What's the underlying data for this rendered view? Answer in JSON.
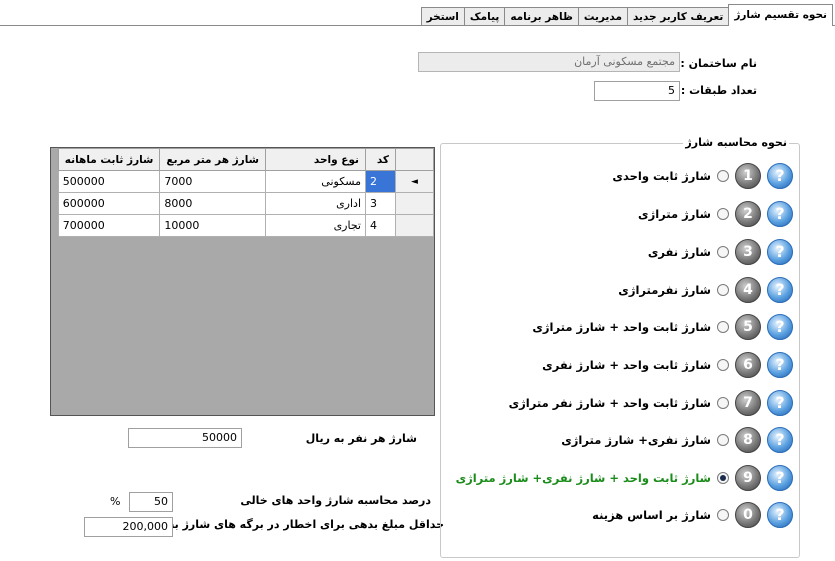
{
  "tabs": [
    "نحوه تقسیم شارژ",
    "تعریف کاربر جدید",
    "مدیریت",
    "ظاهر برنامه",
    "پیامک",
    "استخر"
  ],
  "building": {
    "name_label": "نام ساختمان :",
    "name_value": "مجتمع مسکونی آرمان",
    "floors_label": "تعداد طبقات :",
    "floors_value": "5"
  },
  "grid": {
    "columns": [
      "کد",
      "نوع واحد",
      "شارژ هر متر مربع",
      "شارژ ثابت ماهانه"
    ],
    "rows": [
      {
        "code": "2",
        "type": "مسکونی",
        "per_meter": "7000",
        "fixed": "500000"
      },
      {
        "code": "3",
        "type": "اداری",
        "per_meter": "8000",
        "fixed": "600000"
      },
      {
        "code": "4",
        "type": "تجاری",
        "per_meter": "10000",
        "fixed": "700000"
      }
    ],
    "current_row_marker": "◄"
  },
  "per_person": {
    "label": "شارژ هر نفر به ریال",
    "value": "50000"
  },
  "vacancy": {
    "label": "درصد محاسبه شارژ واحد های خالی",
    "value": "50",
    "unit": "%"
  },
  "min_debt": {
    "label": "حداقل مبلغ بدهی برای اخطار در برگه های شارژ به ریال",
    "value": "200,000"
  },
  "calc_method": {
    "title": "نحوه محاسبه شارژ",
    "help_glyph": "?",
    "options": [
      {
        "num": "1",
        "label": "شارژ ثابت واحدی",
        "selected": false
      },
      {
        "num": "2",
        "label": "شارژ متراژی",
        "selected": false
      },
      {
        "num": "3",
        "label": "شارژ نفری",
        "selected": false
      },
      {
        "num": "4",
        "label": "شارژ نفرمتراژی",
        "selected": false
      },
      {
        "num": "5",
        "label": "شارژ ثابت واحد + شارژ متراژی",
        "selected": false
      },
      {
        "num": "6",
        "label": "شارژ ثابت واحد + شارژ نفری",
        "selected": false
      },
      {
        "num": "7",
        "label": "شارژ ثابت واحد + شارژ نفر متراژی",
        "selected": false
      },
      {
        "num": "8",
        "label": "شارژ نفری+ شارژ متراژی",
        "selected": false
      },
      {
        "num": "9",
        "label": "شارژ ثابت واحد + شارژ نفری+ شارژ متراژی",
        "selected": true
      },
      {
        "num": "0",
        "label": "شارژ بر اساس هزینه",
        "selected": false
      }
    ]
  },
  "colors": {
    "selected_option": "#1a8c1a",
    "selected_cell": "#3875d7",
    "grid_bg": "#a9a9a9"
  }
}
